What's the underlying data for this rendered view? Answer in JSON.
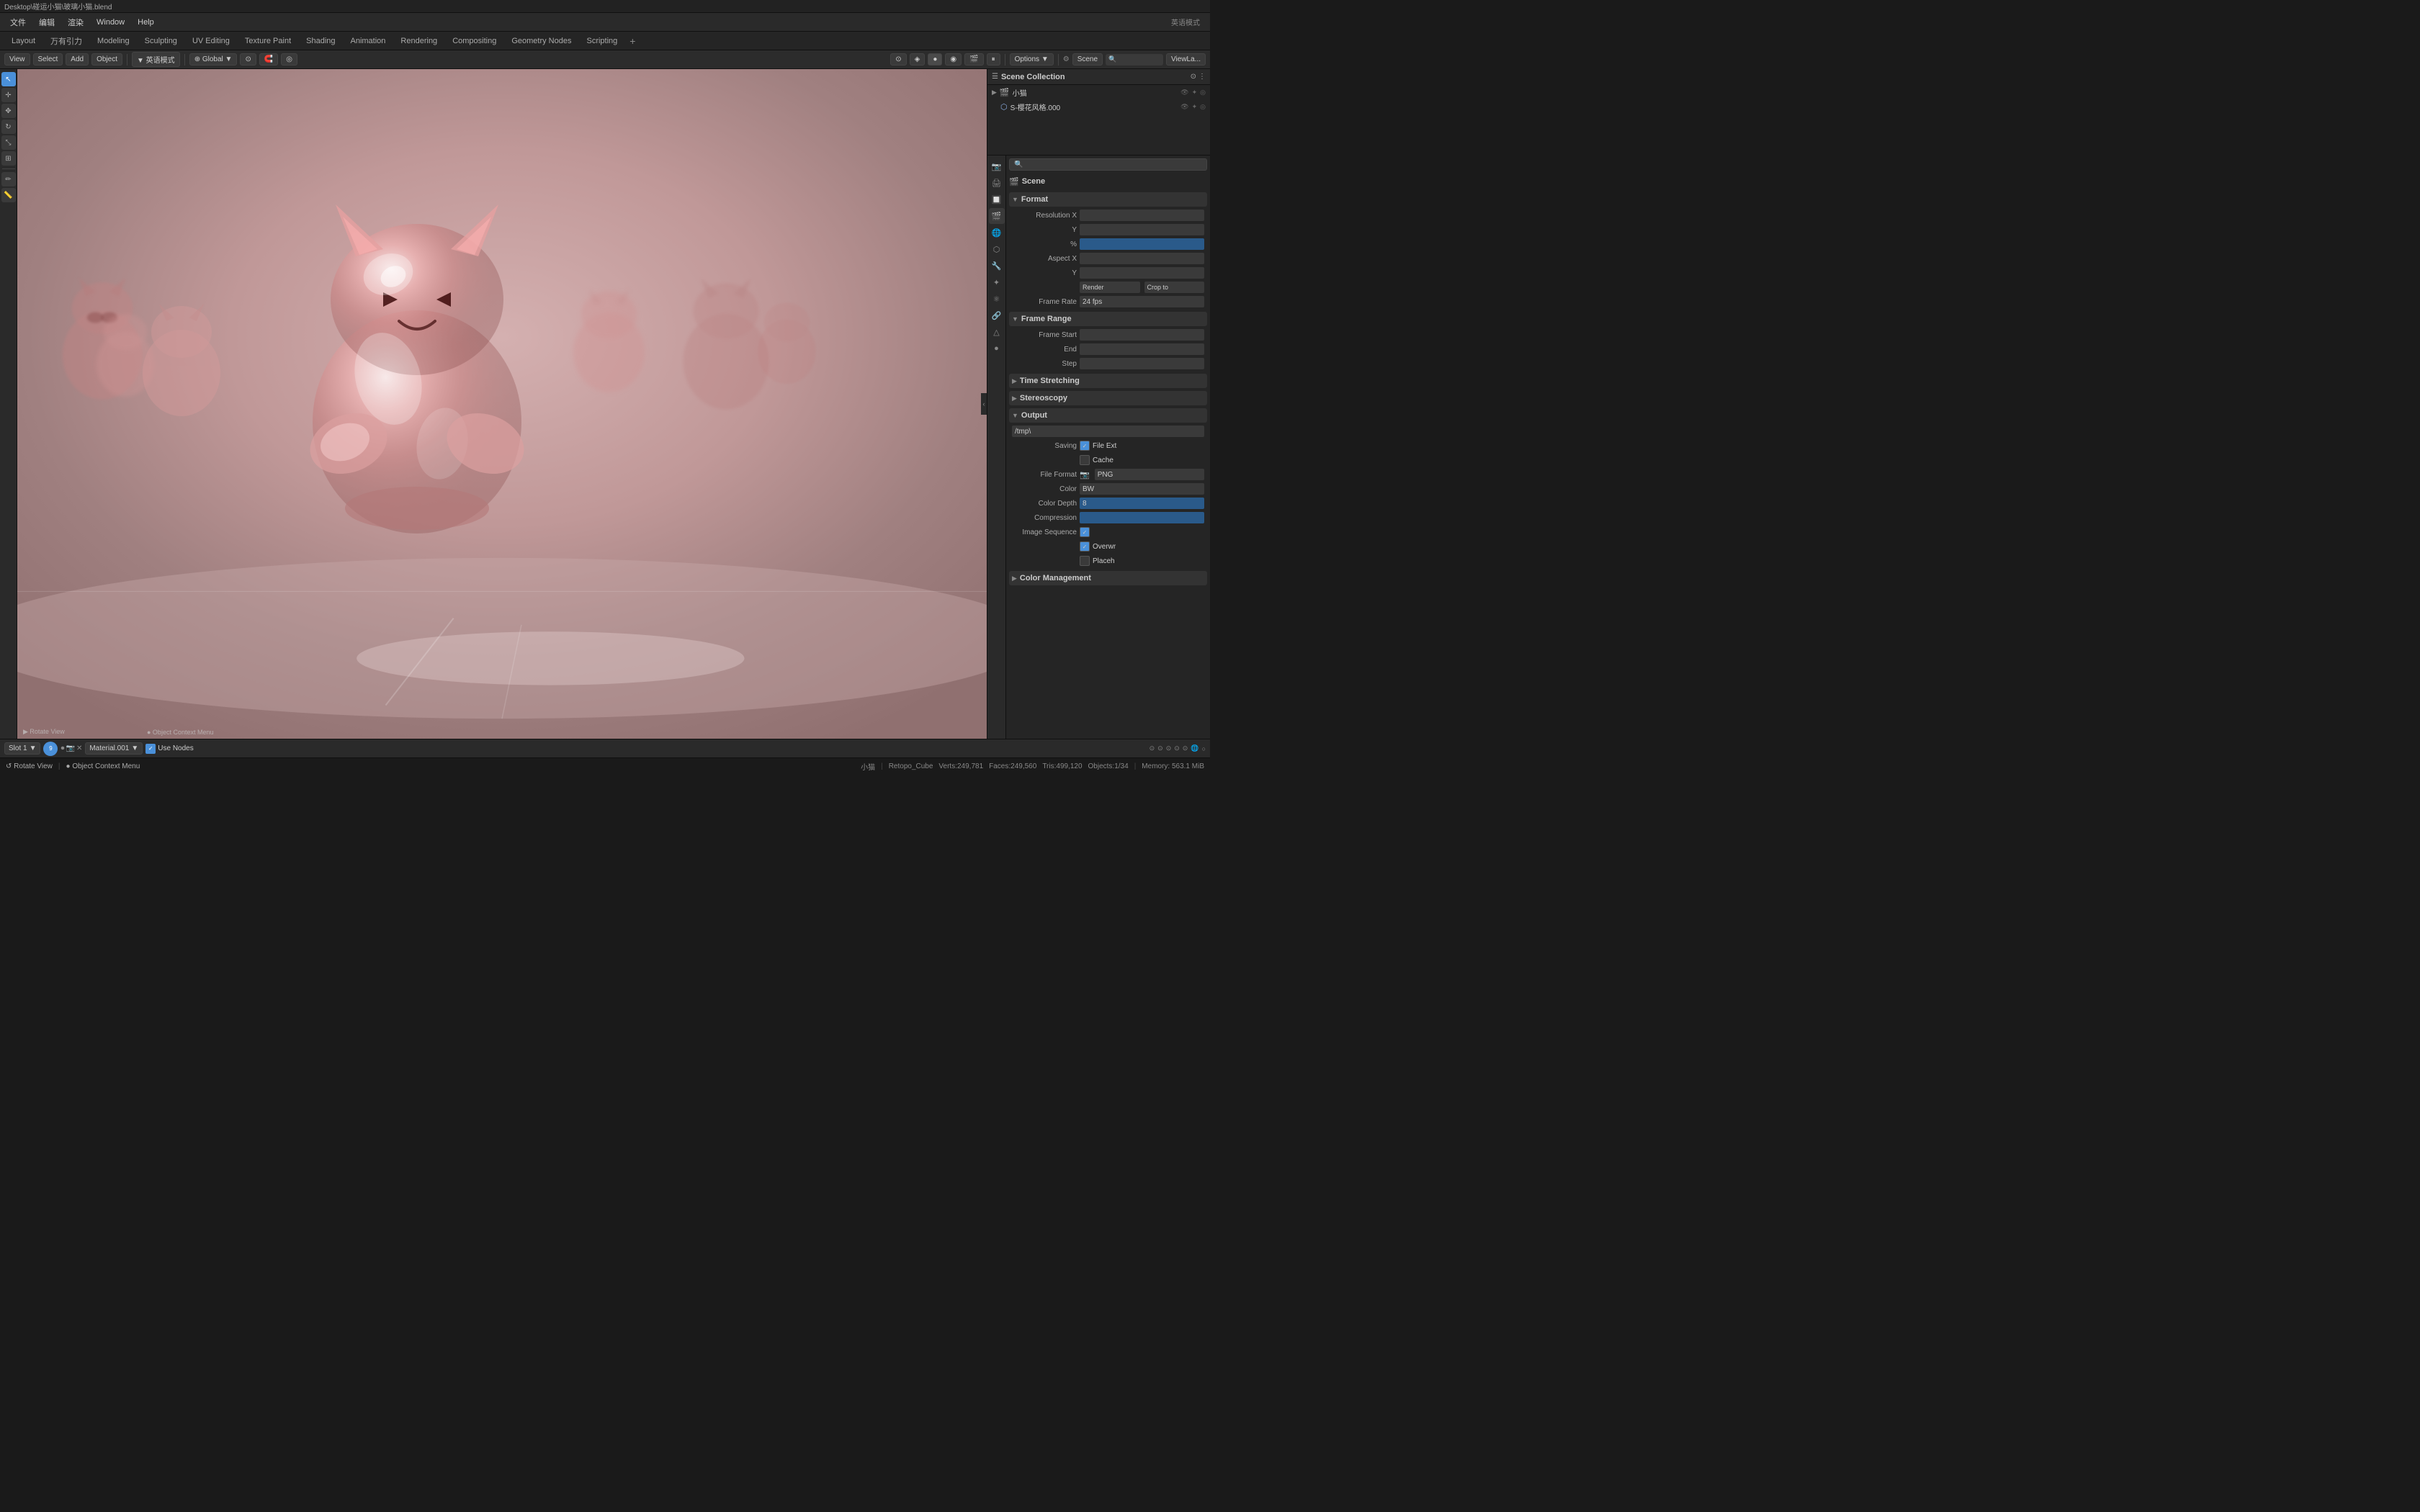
{
  "titlebar": {
    "text": "Desktop\\碰运小猫\\玻璃小猫.blend"
  },
  "menubar": {
    "items": [
      "文件",
      "编辑",
      "渲染",
      "Window",
      "Help"
    ]
  },
  "edit_mode_dropdown": "英语模式",
  "workspace_tabs": {
    "tabs": [
      "Layout",
      "万有引力",
      "Modeling",
      "Sculpting",
      "UV Editing",
      "Texture Paint",
      "Shading",
      "Animation",
      "Rendering",
      "Compositing",
      "Geometry Nodes",
      "Scripting"
    ],
    "active": "Layout",
    "add_label": "+"
  },
  "header_toolbar": {
    "mode_label": "Layout",
    "global_label": "Global",
    "options_label": "Options",
    "scene_label": "Scene",
    "view_label": "ViewLa..."
  },
  "object_header": {
    "items": [
      "文件",
      "View",
      "Select",
      "Add",
      "Object"
    ]
  },
  "select_label": "Select",
  "viewport": {
    "background_color": "#c0a0a0",
    "scene_label": "Scene"
  },
  "outliner": {
    "title": "Scene Collection",
    "items": [
      {
        "name": "小猫",
        "indent": 1,
        "icons": [
          "camera",
          "light",
          "eye"
        ]
      },
      {
        "name": "S-樱花风格.000",
        "indent": 2,
        "icons": [
          "mesh",
          "eye"
        ]
      }
    ]
  },
  "properties": {
    "tabs": [
      "render",
      "output",
      "view_layer",
      "scene",
      "world",
      "object",
      "modifier",
      "particles",
      "physics",
      "constraints",
      "object_data",
      "material",
      "nodes"
    ],
    "active_tab": "scene",
    "scene_label": "Scene",
    "search_placeholder": "",
    "sections": {
      "format": {
        "label": "Format",
        "expanded": true,
        "fields": [
          {
            "label": "Resolution X",
            "value": "",
            "type": "number"
          },
          {
            "label": "Y",
            "value": "",
            "type": "number"
          },
          {
            "label": "%",
            "value": "",
            "type": "number",
            "style": "blue"
          },
          {
            "label": "Aspect X",
            "value": "",
            "type": "number"
          },
          {
            "label": "Y",
            "value": "",
            "type": "number"
          },
          {
            "label": "Render",
            "value": "",
            "type": "button"
          },
          {
            "label": "Crop to",
            "value": "",
            "type": "button"
          },
          {
            "label": "Frame Rate",
            "value": "24 fps",
            "type": "display"
          }
        ]
      },
      "frame_range": {
        "label": "Frame Range",
        "expanded": true,
        "fields": [
          {
            "label": "Frame Start",
            "value": "",
            "type": "number"
          },
          {
            "label": "End",
            "value": "",
            "type": "number"
          },
          {
            "label": "Step",
            "value": "",
            "type": "number"
          }
        ]
      },
      "time_stretching": {
        "label": "Time Stretching",
        "expanded": false
      },
      "stereoscopy": {
        "label": "Stereoscopy",
        "expanded": false
      },
      "output": {
        "label": "Output",
        "expanded": true,
        "path": "/tmp\\",
        "fields": [
          {
            "label": "Saving",
            "type": "checkbox_label",
            "checkbox_label": "File Ext",
            "checked": true
          },
          {
            "label": "",
            "type": "checkbox_label",
            "checkbox_label": "Cache",
            "checked": false
          },
          {
            "label": "File Format",
            "value": "PNG",
            "icon": "camera"
          },
          {
            "label": "Color",
            "value": "BW"
          },
          {
            "label": "Color Depth",
            "value": "8"
          },
          {
            "label": "Compression",
            "value": "",
            "style": "blue"
          },
          {
            "label": "Image Sequence",
            "type": "checkbox_label",
            "checkbox_label": "",
            "checked": true
          },
          {
            "label": "",
            "type": "checkbox_label",
            "checkbox_label": "Overwr",
            "checked": true
          },
          {
            "label": "",
            "type": "checkbox_label",
            "checkbox_label": "Placeh",
            "checked": false
          }
        ]
      },
      "color_management": {
        "label": "Color Management",
        "expanded": false
      }
    }
  },
  "node_bottom": {
    "slot_label": "Slot 1",
    "material_label": "Material.001",
    "slot_number": "9",
    "use_nodes_label": "Use Nodes",
    "use_nodes_checked": true
  },
  "statusbar": {
    "object_label": "小猫",
    "info": "Retopo_Cube",
    "verts": "Verts:249,781",
    "faces": "Faces:249,560",
    "tris": "Tris:499,120",
    "objects": "Objects:1/34",
    "memory": "Memory: 563.1 MiB"
  }
}
